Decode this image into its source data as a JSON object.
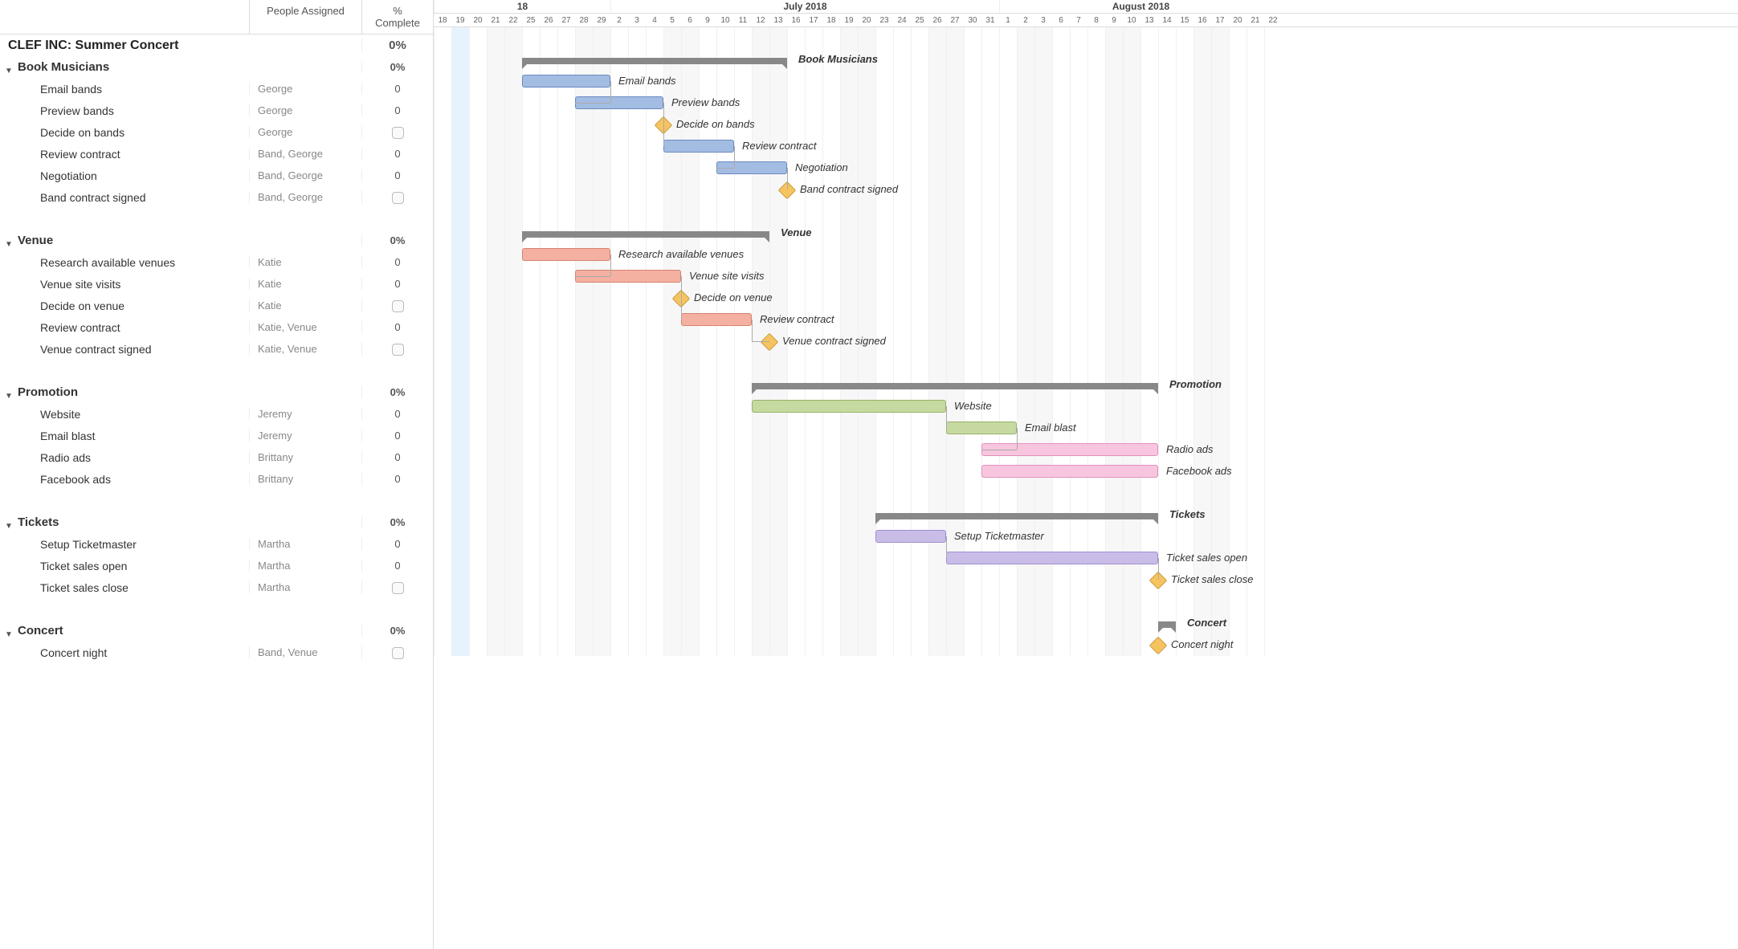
{
  "columns": {
    "people": "People Assigned",
    "complete": "% Complete"
  },
  "project": {
    "title": "CLEF INC: Summer Concert",
    "complete": "0%"
  },
  "months": [
    {
      "label": "18",
      "days": 1,
      "partial_left": true
    },
    {
      "label": "July 2018",
      "days": 31
    },
    {
      "label": "August 2018",
      "days": 12
    }
  ],
  "timeline": {
    "start_day_index": 0,
    "days": [
      {
        "d": "18",
        "w": false
      },
      {
        "d": "19",
        "w": false,
        "today": true
      },
      {
        "d": "20",
        "w": false
      },
      {
        "d": "21",
        "w": true
      },
      {
        "d": "22",
        "w": true
      },
      {
        "d": "25",
        "w": false
      },
      {
        "d": "26",
        "w": false
      },
      {
        "d": "27",
        "w": false
      },
      {
        "d": "28",
        "w": true
      },
      {
        "d": "29",
        "w": true
      },
      {
        "d": "2",
        "w": false
      },
      {
        "d": "3",
        "w": false
      },
      {
        "d": "4",
        "w": false
      },
      {
        "d": "5",
        "w": true
      },
      {
        "d": "6",
        "w": true
      },
      {
        "d": "9",
        "w": false
      },
      {
        "d": "10",
        "w": false
      },
      {
        "d": "11",
        "w": false
      },
      {
        "d": "12",
        "w": true
      },
      {
        "d": "13",
        "w": true
      },
      {
        "d": "16",
        "w": false
      },
      {
        "d": "17",
        "w": false
      },
      {
        "d": "18",
        "w": false
      },
      {
        "d": "19",
        "w": true
      },
      {
        "d": "20",
        "w": true
      },
      {
        "d": "23",
        "w": false
      },
      {
        "d": "24",
        "w": false
      },
      {
        "d": "25",
        "w": false
      },
      {
        "d": "26",
        "w": true
      },
      {
        "d": "27",
        "w": true
      },
      {
        "d": "30",
        "w": false
      },
      {
        "d": "31",
        "w": false
      },
      {
        "d": "1",
        "w": false
      },
      {
        "d": "2",
        "w": true
      },
      {
        "d": "3",
        "w": true
      },
      {
        "d": "6",
        "w": false
      },
      {
        "d": "7",
        "w": false
      },
      {
        "d": "8",
        "w": false
      },
      {
        "d": "9",
        "w": true
      },
      {
        "d": "10",
        "w": true
      },
      {
        "d": "13",
        "w": false
      },
      {
        "d": "14",
        "w": false
      },
      {
        "d": "15",
        "w": false
      },
      {
        "d": "16",
        "w": true
      },
      {
        "d": "17",
        "w": true
      },
      {
        "d": "20",
        "w": false
      },
      {
        "d": "21",
        "w": false
      },
      {
        "d": "22",
        "w": false
      }
    ]
  },
  "rows": [
    {
      "type": "project"
    },
    {
      "type": "group",
      "name": "Book Musicians",
      "complete": "0%",
      "bar": {
        "kind": "summary",
        "start": 5,
        "end": 20,
        "label": "Book Musicians"
      }
    },
    {
      "type": "task",
      "name": "Email bands",
      "people": "George",
      "complete": "0",
      "bar": {
        "kind": "task",
        "color": "blue",
        "start": 5,
        "end": 10,
        "label": "Email bands"
      }
    },
    {
      "type": "task",
      "name": "Preview bands",
      "people": "George",
      "complete": "0",
      "bar": {
        "kind": "task",
        "color": "blue",
        "start": 8,
        "end": 13,
        "label": "Preview bands"
      },
      "dep_from_prev": true
    },
    {
      "type": "task",
      "name": "Decide on bands",
      "people": "George",
      "complete": "checkbox",
      "bar": {
        "kind": "milestone",
        "at": 13,
        "label": "Decide on bands"
      },
      "dep_from_prev": true
    },
    {
      "type": "task",
      "name": "Review contract",
      "people": "Band, George",
      "complete": "0",
      "bar": {
        "kind": "task",
        "color": "blue",
        "start": 13,
        "end": 17,
        "label": "Review contract"
      },
      "dep_from_prev": true
    },
    {
      "type": "task",
      "name": "Negotiation",
      "people": "Band, George",
      "complete": "0",
      "bar": {
        "kind": "task",
        "color": "blue",
        "start": 16,
        "end": 20,
        "label": "Negotiation"
      },
      "dep_from_prev": true
    },
    {
      "type": "task",
      "name": "Band contract signed",
      "people": "Band, George",
      "complete": "checkbox",
      "bar": {
        "kind": "milestone",
        "at": 20,
        "label": "Band contract signed"
      },
      "dep_from_prev": true
    },
    {
      "type": "spacer"
    },
    {
      "type": "group",
      "name": "Venue",
      "complete": "0%",
      "bar": {
        "kind": "summary",
        "start": 5,
        "end": 19,
        "label": "Venue"
      }
    },
    {
      "type": "task",
      "name": "Research available venues",
      "people": "Katie",
      "complete": "0",
      "bar": {
        "kind": "task",
        "color": "salmon",
        "start": 5,
        "end": 10,
        "label": "Research available venues"
      }
    },
    {
      "type": "task",
      "name": "Venue site visits",
      "people": "Katie",
      "complete": "0",
      "bar": {
        "kind": "task",
        "color": "salmon",
        "start": 8,
        "end": 14,
        "label": "Venue site visits"
      },
      "dep_from_prev": true
    },
    {
      "type": "task",
      "name": "Decide on venue",
      "people": "Katie",
      "complete": "checkbox",
      "bar": {
        "kind": "milestone",
        "at": 14,
        "label": "Decide on venue"
      },
      "dep_from_prev": true
    },
    {
      "type": "task",
      "name": "Review contract",
      "people": "Katie, Venue",
      "complete": "0",
      "bar": {
        "kind": "task",
        "color": "salmon",
        "start": 14,
        "end": 18,
        "label": "Review contract"
      },
      "dep_from_prev": true
    },
    {
      "type": "task",
      "name": "Venue contract signed",
      "people": "Katie, Venue",
      "complete": "checkbox",
      "bar": {
        "kind": "milestone",
        "at": 19,
        "label": "Venue contract signed"
      },
      "dep_from_prev": true
    },
    {
      "type": "spacer"
    },
    {
      "type": "group",
      "name": "Promotion",
      "complete": "0%",
      "bar": {
        "kind": "summary",
        "start": 18,
        "end": 41,
        "label": "Promotion"
      }
    },
    {
      "type": "task",
      "name": "Website",
      "people": "Jeremy",
      "complete": "0",
      "bar": {
        "kind": "task",
        "color": "green",
        "start": 18,
        "end": 29,
        "label": "Website"
      }
    },
    {
      "type": "task",
      "name": "Email blast",
      "people": "Jeremy",
      "complete": "0",
      "bar": {
        "kind": "task",
        "color": "green",
        "start": 29,
        "end": 33,
        "label": "Email blast"
      },
      "dep_from_prev": true
    },
    {
      "type": "task",
      "name": "Radio ads",
      "people": "Brittany",
      "complete": "0",
      "bar": {
        "kind": "task",
        "color": "pink",
        "start": 31,
        "end": 41,
        "label": "Radio ads"
      },
      "dep_from_prev": true
    },
    {
      "type": "task",
      "name": "Facebook ads",
      "people": "Brittany",
      "complete": "0",
      "bar": {
        "kind": "task",
        "color": "pink",
        "start": 31,
        "end": 41,
        "label": "Facebook ads"
      }
    },
    {
      "type": "spacer"
    },
    {
      "type": "group",
      "name": "Tickets",
      "complete": "0%",
      "bar": {
        "kind": "summary",
        "start": 25,
        "end": 41,
        "label": "Tickets"
      }
    },
    {
      "type": "task",
      "name": "Setup Ticketmaster",
      "people": "Martha",
      "complete": "0",
      "bar": {
        "kind": "task",
        "color": "purple",
        "start": 25,
        "end": 29,
        "label": "Setup Ticketmaster"
      }
    },
    {
      "type": "task",
      "name": "Ticket sales open",
      "people": "Martha",
      "complete": "0",
      "bar": {
        "kind": "task",
        "color": "purple",
        "start": 29,
        "end": 41,
        "label": "Ticket sales open"
      },
      "dep_from_prev": true
    },
    {
      "type": "task",
      "name": "Ticket sales close",
      "people": "Martha",
      "complete": "checkbox",
      "bar": {
        "kind": "milestone",
        "at": 41,
        "label": "Ticket sales close"
      },
      "dep_from_prev": true
    },
    {
      "type": "spacer"
    },
    {
      "type": "group",
      "name": "Concert",
      "complete": "0%",
      "bar": {
        "kind": "summary",
        "start": 41,
        "end": 42,
        "label": "Concert"
      }
    },
    {
      "type": "task",
      "name": "Concert night",
      "people": "Band, Venue",
      "complete": "checkbox",
      "bar": {
        "kind": "milestone",
        "at": 41,
        "label": "Concert night"
      }
    }
  ],
  "chart_data": {
    "type": "gantt",
    "title": "CLEF INC: Summer Concert",
    "date_columns_visible": [
      "Jun 18",
      "Jun 19",
      "Jun 20",
      "Jun 21",
      "Jun 22",
      "Jun 25",
      "Jun 26",
      "Jun 27",
      "Jun 28",
      "Jun 29",
      "Jul 2",
      "Jul 3",
      "Jul 4",
      "Jul 5",
      "Jul 6",
      "Jul 9",
      "Jul 10",
      "Jul 11",
      "Jul 12",
      "Jul 13",
      "Jul 16",
      "Jul 17",
      "Jul 18",
      "Jul 19",
      "Jul 20",
      "Jul 23",
      "Jul 24",
      "Jul 25",
      "Jul 26",
      "Jul 27",
      "Jul 30",
      "Jul 31",
      "Aug 1",
      "Aug 2",
      "Aug 3",
      "Aug 6",
      "Aug 7",
      "Aug 8",
      "Aug 9",
      "Aug 10",
      "Aug 13",
      "Aug 14",
      "Aug 15",
      "Aug 16",
      "Aug 17",
      "Aug 20",
      "Aug 21",
      "Aug 22"
    ],
    "today_highlight": "Jun 19",
    "groups": [
      {
        "name": "Book Musicians",
        "percent_complete": 0,
        "span": [
          "Jun 25",
          "Jul 16"
        ],
        "tasks": [
          {
            "name": "Email bands",
            "assignee": "George",
            "pct": 0,
            "span_cols": [
              "Jun 25",
              "Jul 2"
            ],
            "type": "task"
          },
          {
            "name": "Preview bands",
            "assignee": "George",
            "pct": 0,
            "span_cols": [
              "Jun 28",
              "Jul 5"
            ],
            "type": "task"
          },
          {
            "name": "Decide on bands",
            "assignee": "George",
            "type": "milestone",
            "at_col": "Jul 5"
          },
          {
            "name": "Review contract",
            "assignee": "Band, George",
            "pct": 0,
            "span_cols": [
              "Jul 5",
              "Jul 11"
            ],
            "type": "task"
          },
          {
            "name": "Negotiation",
            "assignee": "Band, George",
            "pct": 0,
            "span_cols": [
              "Jul 10",
              "Jul 16"
            ],
            "type": "task"
          },
          {
            "name": "Band contract signed",
            "assignee": "Band, George",
            "type": "milestone",
            "at_col": "Jul 16"
          }
        ]
      },
      {
        "name": "Venue",
        "percent_complete": 0,
        "span": [
          "Jun 25",
          "Jul 13"
        ],
        "tasks": [
          {
            "name": "Research available venues",
            "assignee": "Katie",
            "pct": 0,
            "span_cols": [
              "Jun 25",
              "Jul 2"
            ],
            "type": "task"
          },
          {
            "name": "Venue site visits",
            "assignee": "Katie",
            "pct": 0,
            "span_cols": [
              "Jun 28",
              "Jul 6"
            ],
            "type": "task"
          },
          {
            "name": "Decide on venue",
            "assignee": "Katie",
            "type": "milestone",
            "at_col": "Jul 6"
          },
          {
            "name": "Review contract",
            "assignee": "Katie, Venue",
            "pct": 0,
            "span_cols": [
              "Jul 6",
              "Jul 12"
            ],
            "type": "task"
          },
          {
            "name": "Venue contract signed",
            "assignee": "Katie, Venue",
            "type": "milestone",
            "at_col": "Jul 13"
          }
        ]
      },
      {
        "name": "Promotion",
        "percent_complete": 0,
        "span": [
          "Jul 12",
          "Aug 14"
        ],
        "tasks": [
          {
            "name": "Website",
            "assignee": "Jeremy",
            "pct": 0,
            "span_cols": [
              "Jul 12",
              "Jul 27"
            ],
            "type": "task"
          },
          {
            "name": "Email blast",
            "assignee": "Jeremy",
            "pct": 0,
            "span_cols": [
              "Jul 27",
              "Aug 2"
            ],
            "type": "task"
          },
          {
            "name": "Radio ads",
            "assignee": "Brittany",
            "pct": 0,
            "span_cols": [
              "Jul 31",
              "Aug 14"
            ],
            "type": "task"
          },
          {
            "name": "Facebook ads",
            "assignee": "Brittany",
            "pct": 0,
            "span_cols": [
              "Jul 31",
              "Aug 14"
            ],
            "type": "task"
          }
        ]
      },
      {
        "name": "Tickets",
        "percent_complete": 0,
        "span": [
          "Jul 23",
          "Aug 14"
        ],
        "tasks": [
          {
            "name": "Setup Ticketmaster",
            "assignee": "Martha",
            "pct": 0,
            "span_cols": [
              "Jul 23",
              "Jul 27"
            ],
            "type": "task"
          },
          {
            "name": "Ticket sales open",
            "assignee": "Martha",
            "pct": 0,
            "span_cols": [
              "Jul 27",
              "Aug 14"
            ],
            "type": "task"
          },
          {
            "name": "Ticket sales close",
            "assignee": "Martha",
            "type": "milestone",
            "at_col": "Aug 14"
          }
        ]
      },
      {
        "name": "Concert",
        "percent_complete": 0,
        "span": [
          "Aug 14",
          "Aug 15"
        ],
        "tasks": [
          {
            "name": "Concert night",
            "assignee": "Band, Venue",
            "type": "milestone",
            "at_col": "Aug 14"
          }
        ]
      }
    ]
  }
}
